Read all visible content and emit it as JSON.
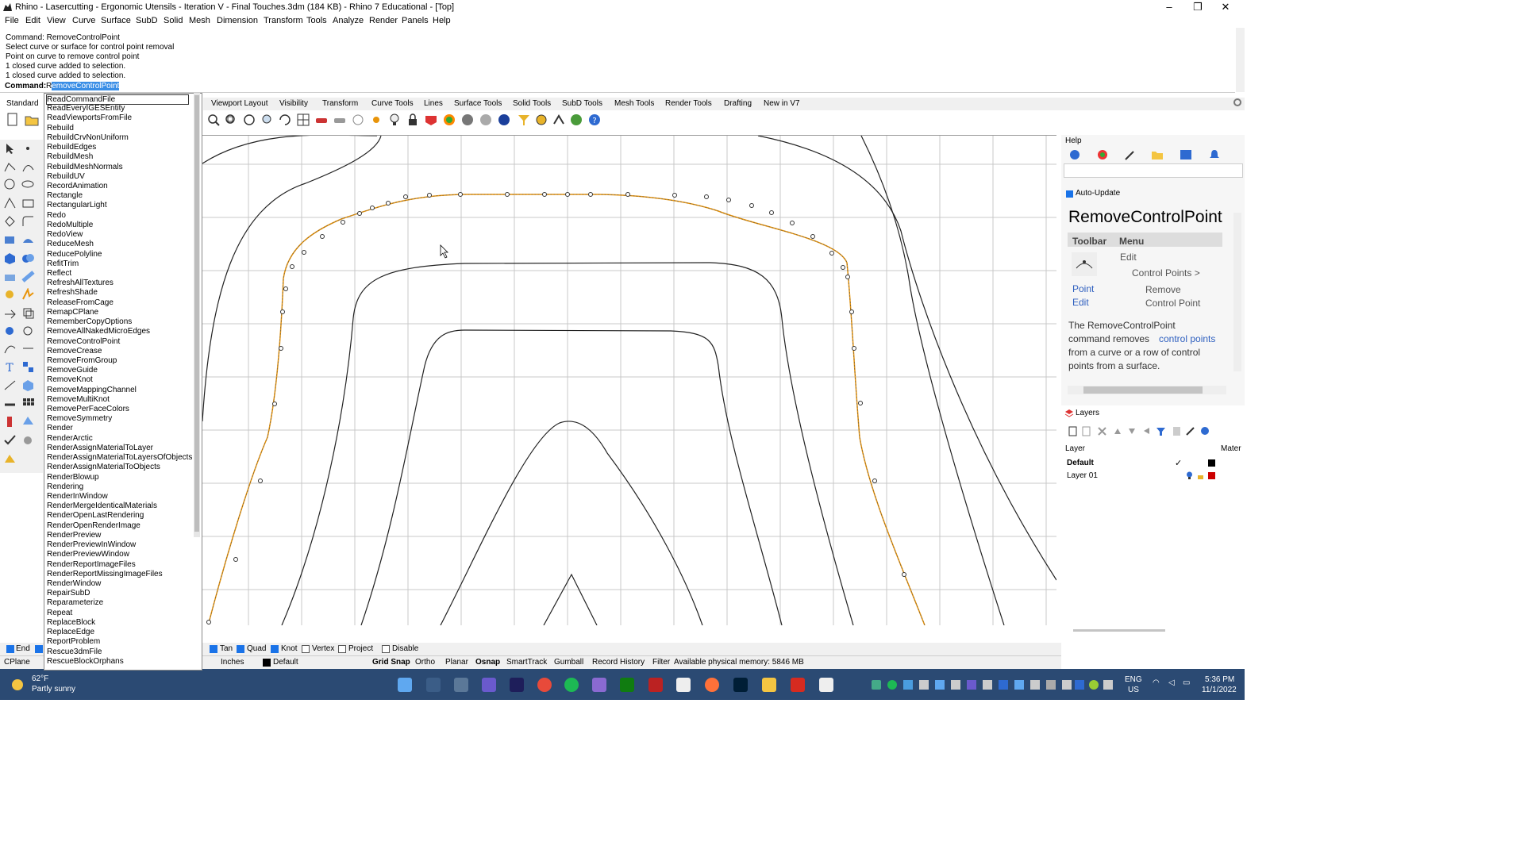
{
  "window": {
    "title": "Rhino - Lasercutting - Ergonomic Utensils - Iteration V - Final Touches.3dm (184 KB) - Rhino 7 Educational - [Top]",
    "minimize": "–",
    "maximize": "❐",
    "close": "✕"
  },
  "menu": [
    "File",
    "Edit",
    "View",
    "Curve",
    "Surface",
    "SubD",
    "Solid",
    "Mesh",
    "Dimension",
    "Transform",
    "Tools",
    "Analyze",
    "Render",
    "Panels",
    "Help"
  ],
  "command_history": [
    "Command: RemoveControlPoint",
    "Select curve or surface for control point removal",
    "Point on curve to remove control point",
    "1 closed curve added to selection.",
    "1 closed curve added to selection."
  ],
  "command_line": {
    "label": "Command:",
    "typed": "R",
    "completion": "emoveControlPoint"
  },
  "toolbar_tabs": [
    "Viewport Layout",
    "Visibility",
    "Transform",
    "Curve Tools",
    "Lines",
    "Surface Tools",
    "Solid Tools",
    "SubD Tools",
    "Mesh Tools",
    "Render Tools",
    "Drafting",
    "New in V7"
  ],
  "standard_tab": "Standard",
  "autocomplete": [
    "ReadCommandFile",
    "ReadEveryIGESEntity",
    "ReadViewportsFromFile",
    "Rebuild",
    "RebuildCrvNonUniform",
    "RebuildEdges",
    "RebuildMesh",
    "RebuildMeshNormals",
    "RebuildUV",
    "RecordAnimation",
    "Rectangle",
    "RectangularLight",
    "Redo",
    "RedoMultiple",
    "RedoView",
    "ReduceMesh",
    "ReducePolyline",
    "RefitTrim",
    "Reflect",
    "RefreshAllTextures",
    "RefreshShade",
    "ReleaseFromCage",
    "RemapCPlane",
    "RememberCopyOptions",
    "RemoveAllNakedMicroEdges",
    "RemoveControlPoint",
    "RemoveCrease",
    "RemoveFromGroup",
    "RemoveGuide",
    "RemoveKnot",
    "RemoveMappingChannel",
    "RemoveMultiKnot",
    "RemovePerFaceColors",
    "RemoveSymmetry",
    "Render",
    "RenderArctic",
    "RenderAssignMaterialToLayer",
    "RenderAssignMaterialToLayersOfObjects",
    "RenderAssignMaterialToObjects",
    "RenderBlowup",
    "Rendering",
    "RenderInWindow",
    "RenderMergeIdenticalMaterials",
    "RenderOpenLastRendering",
    "RenderOpenRenderImage",
    "RenderPreview",
    "RenderPreviewInWindow",
    "RenderPreviewWindow",
    "RenderReportImageFiles",
    "RenderReportMissingImageFiles",
    "RenderWindow",
    "RepairSubD",
    "Reparameterize",
    "Repeat",
    "ReplaceBlock",
    "ReplaceEdge",
    "ReportProblem",
    "Rescue3dmFile",
    "RescueBlockOrphans"
  ],
  "help": {
    "panel_label": "Help",
    "auto_update": "Auto-Update",
    "title": "RemoveControlPoint",
    "col_toolbar": "Toolbar",
    "col_menu": "Menu",
    "toolbar_link1": "Point",
    "toolbar_link2": "Edit",
    "menu_path1": "Edit",
    "menu_path2": "Control Points >",
    "menu_path3": "Remove",
    "menu_path4": "Control Point",
    "desc1": "The RemoveControlPoint",
    "desc2": "command removes",
    "desc_link": "control points",
    "desc3": "from a curve or a row of control",
    "desc4": "points from a surface."
  },
  "layers": {
    "panel_label": "Layers",
    "col_layer": "Layer",
    "col_material": "Mater",
    "rows": [
      {
        "name": "Default",
        "current": true,
        "color": "#000000"
      },
      {
        "name": "Layer 01",
        "current": false,
        "color": "#cc0000"
      }
    ]
  },
  "osnap": {
    "end": "End",
    "tan": "Tan",
    "quad": "Quad",
    "knot": "Knot",
    "vertex": "Vertex",
    "project": "Project",
    "disable": "Disable"
  },
  "status": {
    "cplane": "CPlane",
    "units": "Inches",
    "layer": "Default",
    "grid_snap": "Grid Snap",
    "ortho": "Ortho",
    "planar": "Planar",
    "osnap": "Osnap",
    "smarttrack": "SmartTrack",
    "gumball": "Gumball",
    "record_history": "Record History",
    "filter": "Filter",
    "memory": "Available physical memory: 5846 MB"
  },
  "taskbar": {
    "temp": "62°F",
    "weather": "Partly sunny",
    "lang1": "ENG",
    "lang2": "US",
    "time": "5:36 PM",
    "date": "11/1/2022"
  },
  "colors": {
    "selected_curve": "#e8940a",
    "accent": "#1a73e8",
    "taskbar": "#2b4a73"
  }
}
